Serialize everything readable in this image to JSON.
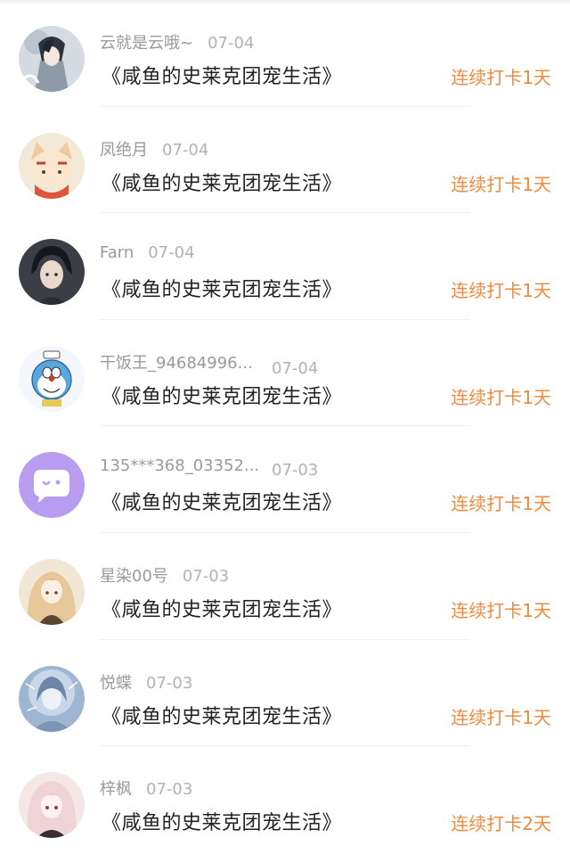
{
  "items": [
    {
      "name": "云就是云哦~",
      "date": "07-04",
      "book": "《咸鱼的史莱克团宠生活》",
      "streak": "连续打卡1天",
      "avatar": "anime-boy-avatar",
      "avatar_bg": "#c9cfd6"
    },
    {
      "name": "凤绝月",
      "date": "07-04",
      "book": "《咸鱼的史莱克团宠生活》",
      "streak": "连续打卡1天",
      "avatar": "cat-cartoon-avatar",
      "avatar_bg": "#f1e6d3"
    },
    {
      "name": "Farn",
      "date": "07-04",
      "book": "《咸鱼的史莱克团宠生活》",
      "streak": "连续打卡1天",
      "avatar": "dark-hair-boy-avatar",
      "avatar_bg": "#4a4f56"
    },
    {
      "name": "干饭王_94684996...",
      "date": "07-04",
      "book": "《咸鱼的史莱克团宠生活》",
      "streak": "连续打卡1天",
      "avatar": "doraemon-avatar",
      "avatar_bg": "#e7f2fb"
    },
    {
      "name": "135***368_03352...",
      "date": "07-03",
      "book": "《咸鱼的史莱克团宠生活》",
      "streak": "连续打卡1天",
      "avatar": "chat-bubble-avatar",
      "avatar_bg": "#b79cf0"
    },
    {
      "name": "星染00号",
      "date": "07-03",
      "book": "《咸鱼的史莱克团宠生活》",
      "streak": "连续打卡1天",
      "avatar": "anime-girl-avatar",
      "avatar_bg": "#efe3cf"
    },
    {
      "name": "悦蝶",
      "date": "07-03",
      "book": "《咸鱼的史莱克团宠生活》",
      "streak": "连续打卡1天",
      "avatar": "blue-fantasy-avatar",
      "avatar_bg": "#b9cbe0"
    },
    {
      "name": "梓枫",
      "date": "07-03",
      "book": "《咸鱼的史莱克团宠生活》",
      "streak": "连续打卡2天",
      "avatar": "pink-hair-girl-avatar",
      "avatar_bg": "#f2dede"
    }
  ]
}
